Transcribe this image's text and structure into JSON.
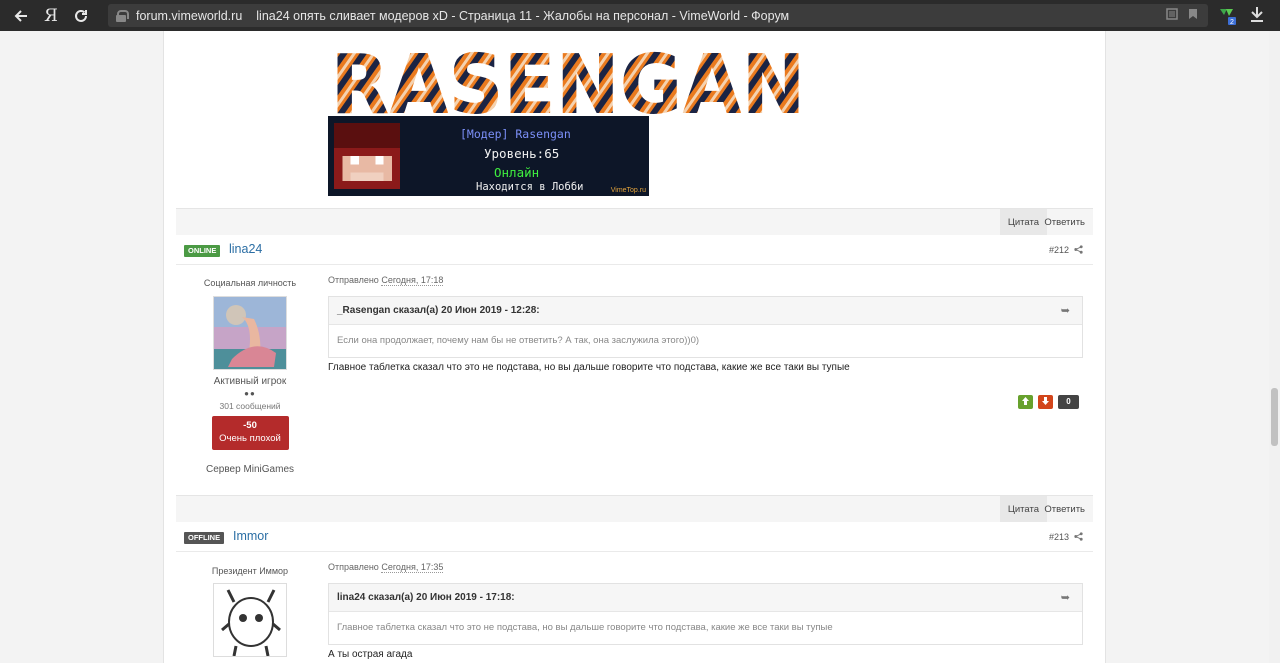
{
  "browser": {
    "yandex_label": "Я",
    "domain": "forum.vimeworld.ru",
    "tab_title": "lina24 опять сливает модеров xD - Страница 11 - Жалобы на персонал - VimeWorld - Форум",
    "ext_badge": "2"
  },
  "signature": {
    "logo_text": "RASENGAN",
    "banner_name": "[Модер] Rasengan",
    "banner_level": "Уровень:65",
    "banner_status": "Онлайн",
    "banner_location": "Находится в Лобби",
    "banner_site": "VimeTop.ru"
  },
  "controls": {
    "quote_label": "Цитата",
    "reply_label": "Ответить"
  },
  "posts": [
    {
      "status": "ONLINE",
      "author": "lina24",
      "number": "#212",
      "group_title": "Социальная личность",
      "rank": "Активный игрок",
      "pips": "●●",
      "post_count": "301 сообщений",
      "rep_value": "-50",
      "rep_label": "Очень плохой",
      "server_label": "Сервер",
      "server_value": "MiniGames",
      "posted_prefix": "Отправлено",
      "posted_date": "Сегодня, 17:18",
      "quote_head": "_Rasengan сказал(а) 20 Июн 2019 - 12:28:",
      "quote_text": "Если она продолжает, почему нам бы не ответить? А так, она заслужила этого))0)",
      "text": "Главное таблетка сказал что это не подстава, но вы дальше говорите что подстава, какие же все таки вы тупые",
      "vote_count": "0"
    },
    {
      "status": "OFFLINE",
      "author": "Immor",
      "number": "#213",
      "group_title": "Президент Иммор",
      "posted_prefix": "Отправлено",
      "posted_date": "Сегодня, 17:35",
      "quote_head": "lina24 сказал(а) 20 Июн 2019 - 17:18:",
      "quote_text": "Главное таблетка сказал что это не подстава, но вы дальше говорите что подстава, какие же все таки вы тупые",
      "text": "А ты острая агада"
    }
  ]
}
